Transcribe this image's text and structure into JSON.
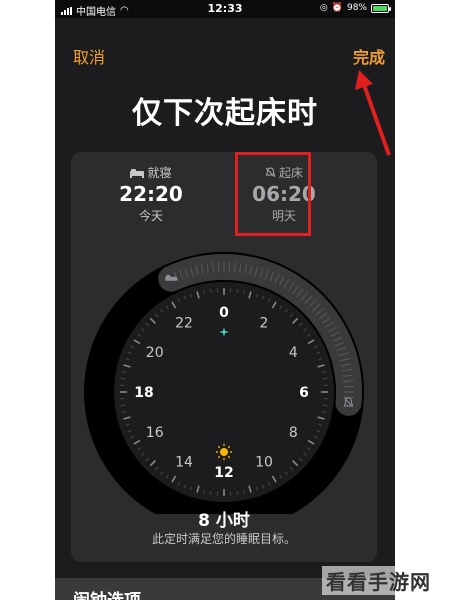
{
  "status_bar": {
    "carrier": "中国电信",
    "time": "12:33",
    "battery": "98%",
    "battery_level": 0.98
  },
  "nav": {
    "cancel_label": "取消",
    "done_label": "完成"
  },
  "title": "仅下次起床时",
  "bedtime": {
    "label": "就寝",
    "time": "22:20",
    "day": "今天",
    "icon": "bed-icon"
  },
  "wakeup": {
    "label": "起床",
    "time": "06:20",
    "day": "明天",
    "icon": "alarm-bell-icon"
  },
  "clock": {
    "hours": [
      "0",
      "2",
      "4",
      "6",
      "8",
      "10",
      "12",
      "14",
      "16",
      "18",
      "20",
      "22"
    ],
    "bedtime_hour": 22.333,
    "wake_hour": 6.333
  },
  "duration": "8 小时",
  "goal_text": "此定时满足您的睡眠目标。",
  "section_title": "闹钟选项",
  "watermark": "看看手游网",
  "colors": {
    "accent": "#f0a030",
    "highlight": "#e02020",
    "card": "#2c2c2e",
    "background": "#1c1c1e"
  }
}
